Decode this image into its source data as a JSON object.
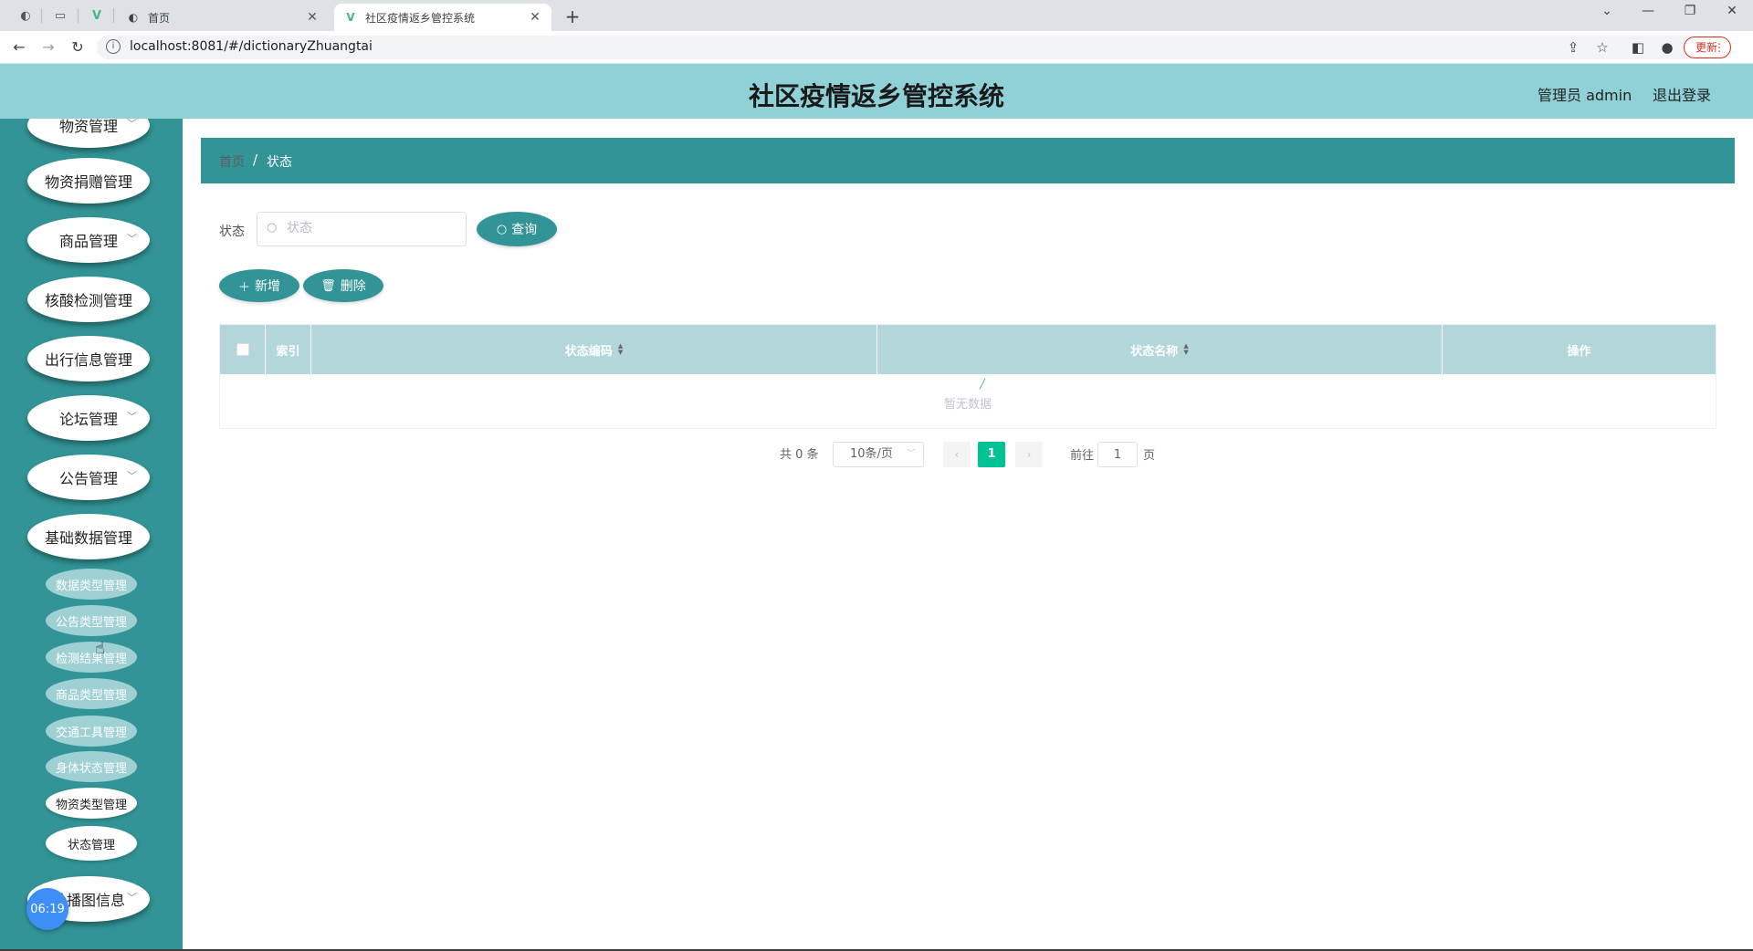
{
  "browser": {
    "tabs": [
      {
        "title": "首页",
        "active": false
      },
      {
        "title": "社区疫情返乡管控系统",
        "active": true
      }
    ],
    "url": "localhost:8081/#/dictionaryZhuangtai",
    "update_label": "更新"
  },
  "header": {
    "title": "社区疫情返乡管控系统",
    "user": "管理员 admin",
    "logout": "退出登录"
  },
  "sidebar": {
    "items": [
      {
        "label": "物资管理",
        "has_arrow": true
      },
      {
        "label": "物资捐赠管理",
        "has_arrow": false
      },
      {
        "label": "商品管理",
        "has_arrow": true
      },
      {
        "label": "核酸检测管理",
        "has_arrow": false
      },
      {
        "label": "出行信息管理",
        "has_arrow": false
      },
      {
        "label": "论坛管理",
        "has_arrow": true
      },
      {
        "label": "公告管理",
        "has_arrow": true
      },
      {
        "label": "基础数据管理",
        "has_arrow": false
      }
    ],
    "subitems": [
      {
        "label": "数据类型管理"
      },
      {
        "label": "公告类型管理"
      },
      {
        "label": "检测结果管理"
      },
      {
        "label": "商品类型管理"
      },
      {
        "label": "交通工具管理"
      },
      {
        "label": "身体状态管理"
      },
      {
        "label": "物资类型管理"
      },
      {
        "label": "状态管理"
      }
    ],
    "last_item": "轮播图信息",
    "clock": "06:19"
  },
  "breadcrumb": {
    "home": "首页",
    "separator": "/",
    "current": "状态"
  },
  "search": {
    "label": "状态",
    "placeholder": "状态",
    "query_button": "查询"
  },
  "actions": {
    "add": "新增",
    "delete": "删除"
  },
  "table": {
    "columns": [
      "索引",
      "状态编码",
      "状态名称",
      "操作"
    ],
    "empty_text": "暂无数据"
  },
  "pagination": {
    "total": "共 0 条",
    "page_size": "10条/页",
    "current_page": "1",
    "goto_label": "前往",
    "goto_value": "1",
    "page_suffix": "页"
  },
  "colors": {
    "primary": "#329496",
    "header": "#90d1d7",
    "page_active": "#00c292"
  }
}
